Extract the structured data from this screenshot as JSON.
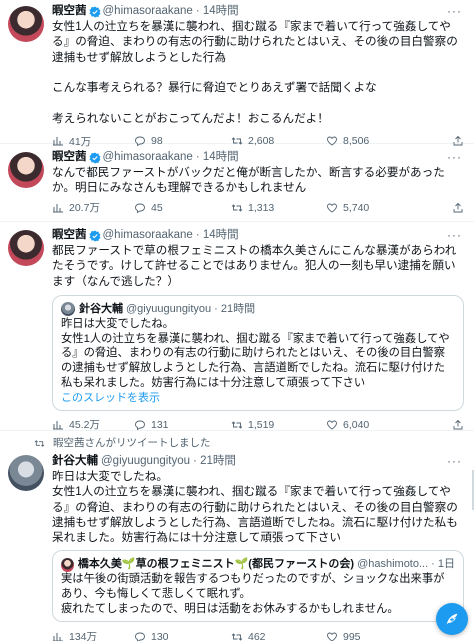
{
  "tweets": [
    {
      "name": "暇空茜",
      "handle": "@himasoraakane",
      "time": "· 14時間",
      "text": "女性1人の辻立ちを暴漢に襲われ、掴む蹴る『家まで着いて行って強姦してやる』の脅迫、まわりの有志の行動に助けられたとはいえ、その後の目白警察の逮捕もせず解放しようとした行為\n\nこんな事考えられる？暴行に脅迫でとりあえず署で話聞くよな\n\n考えられないことがおこってんだよ！おこるんだよ！",
      "views": "41万",
      "replies": "98",
      "retweets": "2,608",
      "likes": "8,506"
    },
    {
      "name": "暇空茜",
      "handle": "@himasoraakane",
      "time": "· 14時間",
      "text": "なんで都民ファーストがバックだと俺が断言したか、断言する必要があったか。明日にみなさんも理解できるかもしれません",
      "views": "20.7万",
      "replies": "45",
      "retweets": "1,313",
      "likes": "5,740"
    },
    {
      "name": "暇空茜",
      "handle": "@himasoraakane",
      "time": "· 14時間",
      "text": "都民ファーストで草の根フェミニストの橋本久美さんにこんな暴漢があらわれたそうです。けして許せることではありません。犯人の一刻も早い逮捕を願います（なんで逃した？）",
      "quote": {
        "name": "針谷大輔",
        "handle": "@giyuugungityou",
        "time": "· 21時間",
        "text": "昨日は大変でしたね。\n女性1人の辻立ちを暴漢に襲われ、掴む蹴る『家まで着いて行って強姦してやる』の脅迫、まわりの有志の行動に助けられたとはいえ、その後の目白警察の逮捕もせず解放しようとした行為、言語道断でしたね。流石に駆け付けた私も呆れました。妨害行為には十分注意して頑張って下さい",
        "thread_link": "このスレッドを表示"
      },
      "views": "45.2万",
      "replies": "131",
      "retweets": "1,519",
      "likes": "6,040"
    },
    {
      "retweet_banner": "暇空茜さんがリツイートしました",
      "name": "針谷大輔",
      "handle": "@giyuugungityou",
      "time": "· 21時間",
      "text": "昨日は大変でしたね。\n女性1人の辻立ちを暴漢に襲われ、掴む蹴る『家まで着いて行って強姦してやる』の脅迫、まわりの有志の行動に助けられたとはいえ、その後の目白警察の逮捕もせず解放しようとした行為、言語道断でしたね。流石に駆け付けた私も呆れました。妨害行為には十分注意して頑張って下さい",
      "quote": {
        "name": "橋本久美🌱草の根フェミニスト🌱(都民ファーストの会)",
        "handle": "@hashimoto...",
        "time": "· 1日",
        "text": "実は午後の街頭活動を報告するつもりだったのですが、ショックな出来事があり、今も悔しくて悲しくて眠れず。\n疲れたてしまったので、明日は活動をお休みするかもしれません。"
      },
      "views": "134万",
      "replies": "130",
      "retweets": "462",
      "likes": "995"
    }
  ],
  "icons": {
    "views": "bar-chart-icon",
    "reply": "speech-bubble-icon",
    "retweet": "retweet-icon",
    "like": "heart-icon",
    "share": "share-icon",
    "more": "more-dots-icon",
    "verified": "verified-badge-icon",
    "compose": "compose-feather-icon"
  },
  "colors": {
    "accent": "#1d9bf0",
    "text": "#0f1419",
    "muted": "#536471",
    "border": "#cfd9de"
  },
  "more_glyph": "···"
}
